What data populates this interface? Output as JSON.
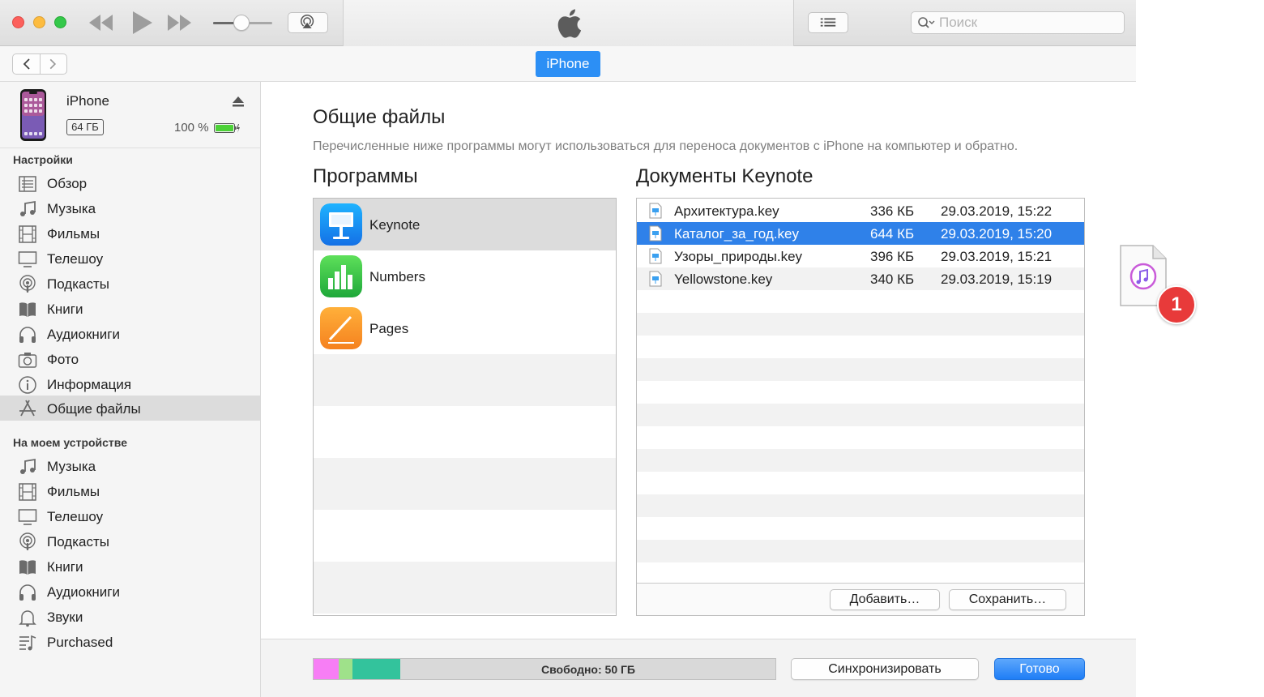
{
  "toolbar": {
    "search_placeholder": "Поиск"
  },
  "navbar": {
    "device_tab": "iPhone"
  },
  "device": {
    "name": "iPhone",
    "capacity": "64 ГБ",
    "battery_percent": "100 %"
  },
  "sidebar": {
    "settings_header": "Настройки",
    "settings_items": [
      {
        "label": "Обзор",
        "icon": "summary-icon"
      },
      {
        "label": "Музыка",
        "icon": "music-note-icon"
      },
      {
        "label": "Фильмы",
        "icon": "film-icon"
      },
      {
        "label": "Телешоу",
        "icon": "tv-icon"
      },
      {
        "label": "Подкасты",
        "icon": "podcast-icon"
      },
      {
        "label": "Книги",
        "icon": "book-icon"
      },
      {
        "label": "Аудиокниги",
        "icon": "headphones-icon"
      },
      {
        "label": "Фото",
        "icon": "camera-icon"
      },
      {
        "label": "Информация",
        "icon": "info-icon"
      },
      {
        "label": "Общие файлы",
        "icon": "app-store-icon",
        "active": true
      }
    ],
    "device_header": "На моем устройстве",
    "device_items": [
      {
        "label": "Музыка",
        "icon": "music-note-icon"
      },
      {
        "label": "Фильмы",
        "icon": "film-icon"
      },
      {
        "label": "Телешоу",
        "icon": "tv-icon"
      },
      {
        "label": "Подкасты",
        "icon": "podcast-icon"
      },
      {
        "label": "Книги",
        "icon": "book-icon"
      },
      {
        "label": "Аудиокниги",
        "icon": "headphones-icon"
      },
      {
        "label": "Звуки",
        "icon": "bell-icon"
      },
      {
        "label": "Purchased",
        "icon": "playlist-icon"
      }
    ]
  },
  "main": {
    "title": "Общие файлы",
    "description": "Перечисленные ниже программы могут использоваться для переноса документов с iPhone на компьютер и обратно.",
    "apps_header": "Программы",
    "apps": [
      {
        "name": "Keynote",
        "icon": "keynote-icon",
        "selected": true
      },
      {
        "name": "Numbers",
        "icon": "numbers-icon"
      },
      {
        "name": "Pages",
        "icon": "pages-icon"
      }
    ],
    "docs_header": "Документы Keynote",
    "documents": [
      {
        "name": "Архитектура.key",
        "size": "336 КБ",
        "date": "29.03.2019, 15:22"
      },
      {
        "name": "Каталог_за_год.key",
        "size": "644 КБ",
        "date": "29.03.2019, 15:20",
        "selected": true
      },
      {
        "name": "Узоры_природы.key",
        "size": "396 КБ",
        "date": "29.03.2019, 15:21"
      },
      {
        "name": "Yellowstone.key",
        "size": "340 КБ",
        "date": "29.03.2019, 15:19"
      }
    ],
    "add_button": "Добавить…",
    "save_button": "Сохранить…"
  },
  "bottom": {
    "free_space": "Свободно: 50 ГБ",
    "sync_button": "Синхронизировать",
    "done_button": "Готово",
    "capacity_colors": [
      "#f77ef5",
      "#9fe18a",
      "#33c39c"
    ]
  },
  "drag": {
    "badge_count": "1"
  }
}
